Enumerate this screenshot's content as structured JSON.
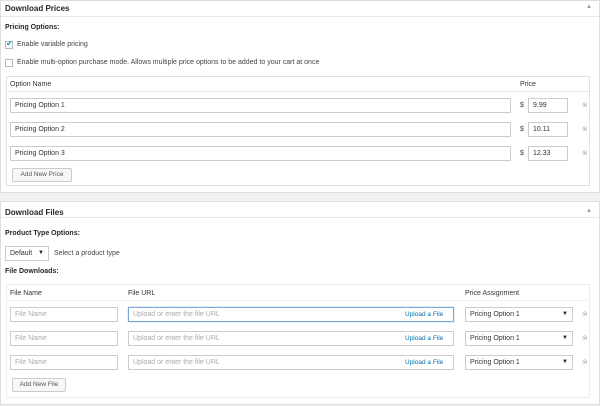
{
  "prices": {
    "title": "Download Prices",
    "pricing_options_label": "Pricing Options:",
    "enable_variable_label": "Enable variable pricing",
    "enable_multi_label": "Enable multi-option purchase mode. Allows multiple price options to be added to your cart at once",
    "col_option_name": "Option Name",
    "col_price": "Price",
    "currency": "$",
    "rows": [
      {
        "name": "Pricing Option 1",
        "price": "9.99"
      },
      {
        "name": "Pricing Option 2",
        "price": "10.11"
      },
      {
        "name": "Pricing Option 3",
        "price": "12.33"
      }
    ],
    "add_button": "Add New Price"
  },
  "files": {
    "title": "Download Files",
    "product_type_label": "Product Type Options:",
    "product_type_value": "Default",
    "product_type_hint": "Select a product type",
    "file_downloads_label": "File Downloads:",
    "col_file_name": "File Name",
    "col_file_url": "File URL",
    "col_price_assignment": "Price Assignment",
    "name_placeholder": "File Name",
    "url_placeholder": "Upload or enter the file URL",
    "upload_label": "Upload a File",
    "rows": [
      {
        "assignment": "Pricing Option 1"
      },
      {
        "assignment": "Pricing Option 1"
      },
      {
        "assignment": "Pricing Option 1"
      }
    ],
    "add_button": "Add New File"
  },
  "icons": {
    "collapse": "triangle-up-icon",
    "remove": "remove-circle-icon",
    "check": "checkmark-icon",
    "dropdown": "triangle-down-icon"
  }
}
